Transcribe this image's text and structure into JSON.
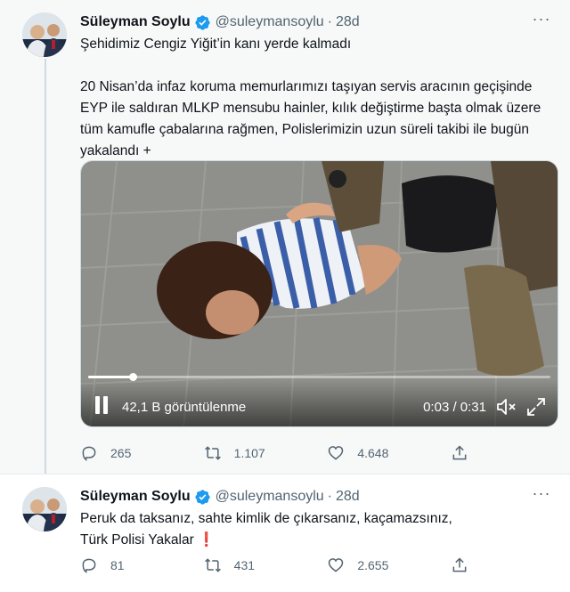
{
  "tweets": [
    {
      "author_name": "Süleyman Soylu",
      "handle": "@suleymansoylu",
      "separator": "·",
      "time": "28d",
      "more": "···",
      "text_lines": [
        "Şehidimiz Cengiz Yiğit’in kanı yerde kalmadı",
        "20 Nisan’da infaz koruma memurlarımızı taşıyan servis aracının geçişinde",
        "EYP ile saldıran MLKP mensubu hainler, kılık değiştirme başta olmak üzere",
        "tüm kamufle çabalarına rağmen, Polislerimizin uzun süreli takibi ile bugün",
        "yakalandı +"
      ],
      "video": {
        "views": "42,1 B görüntülenme",
        "timer": "0:03 / 0:31",
        "progress": 0.097
      },
      "replies": "265",
      "retweets": "1.107",
      "likes": "4.648"
    },
    {
      "author_name": "Süleyman Soylu",
      "handle": "@suleymansoylu",
      "separator": "·",
      "time": "28d",
      "more": "···",
      "text_lines": [
        "Peruk da taksanız, sahte kimlik de çıkarsanız, kaçamazsınız,",
        "Türk Polisi Yakalar ❗"
      ],
      "replies": "81",
      "retweets": "431",
      "likes": "2.655"
    }
  ],
  "colors": {
    "verified": "#1d9bf0",
    "muted": "#536471",
    "text": "#0f1419"
  },
  "icons": [
    "verified-badge-icon",
    "more-icon",
    "pause-icon",
    "volume-muted-icon",
    "fullscreen-icon",
    "reply-icon",
    "retweet-icon",
    "like-icon",
    "share-icon"
  ]
}
